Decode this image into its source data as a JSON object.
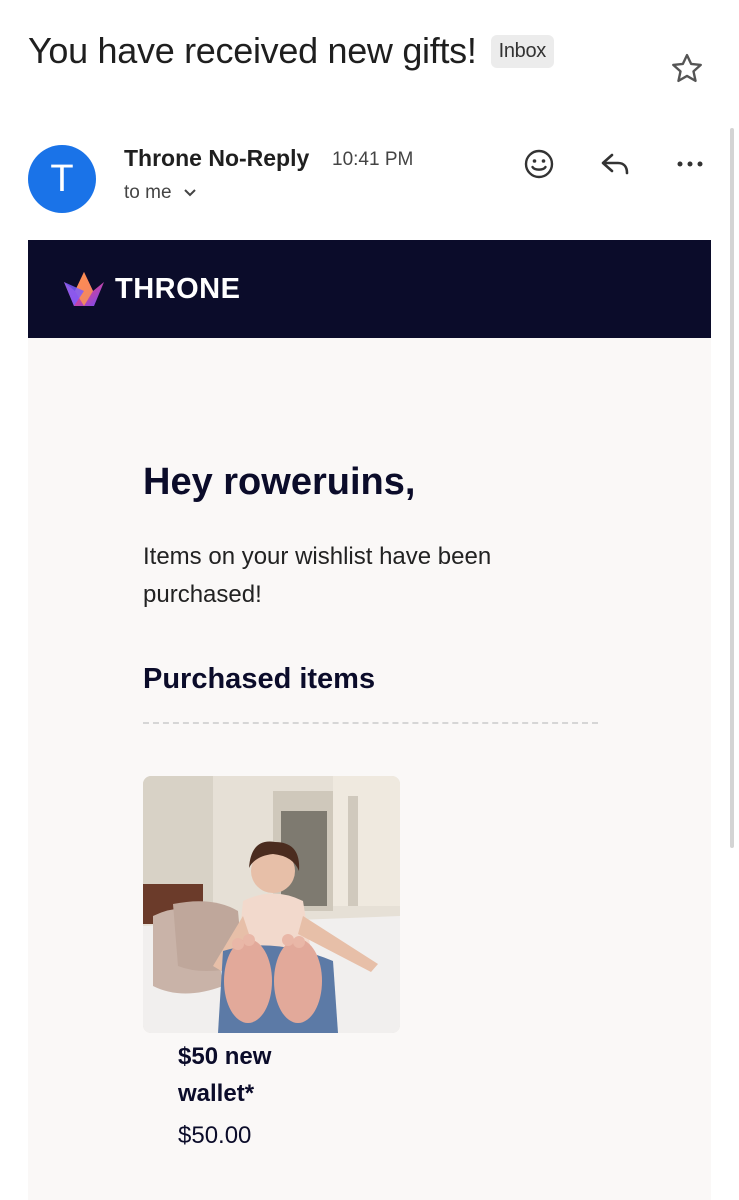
{
  "email": {
    "subject": "You have received new gifts!",
    "label": "Inbox",
    "sender_initial": "T",
    "sender_name": "Throne No-Reply",
    "time": "10:41 PM",
    "recipient": "to me"
  },
  "icons": {
    "star": "star-outline-icon",
    "emoji": "emoji-reaction-icon",
    "reply": "reply-icon",
    "more": "more-options-icon",
    "expand": "chevron-down-icon"
  },
  "brand": {
    "name": "THRONE",
    "header_color": "#0b0c2a",
    "avatar_color": "#1a73e8"
  },
  "content": {
    "greeting": "Hey roweruins,",
    "intro": "Items on your wishlist have been purchased!",
    "purchased_heading": "Purchased items",
    "items": [
      {
        "name": "$50 new wallet*",
        "price": "$50.00"
      }
    ]
  }
}
